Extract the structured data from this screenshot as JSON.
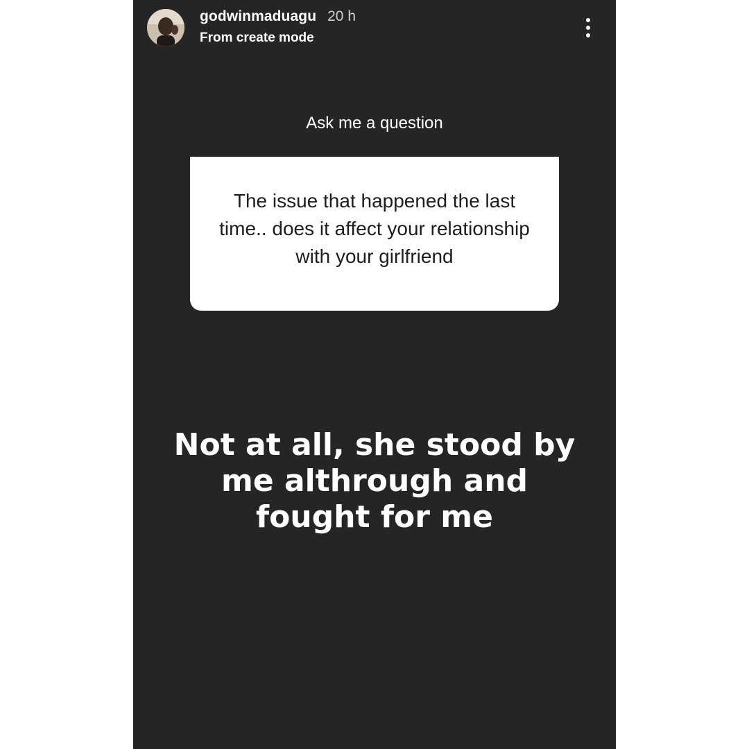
{
  "story": {
    "header": {
      "username": "godwinmaduagu",
      "timestamp": "20 h",
      "subtitle": "From create mode",
      "avatar_icon": "profile-photo",
      "more_icon": "more-vertical-icon"
    },
    "question_sticker": {
      "label": "Ask me a question",
      "question": "The issue that happened the last time.. does it affect your relationship with your girlfriend"
    },
    "answer_text": "Not at all, she stood by me althrough and fought for me",
    "colors": {
      "background": "#252525",
      "text": "#ffffff",
      "sticker_bg": "#ffffff",
      "sticker_text": "#1d1d1d"
    }
  }
}
